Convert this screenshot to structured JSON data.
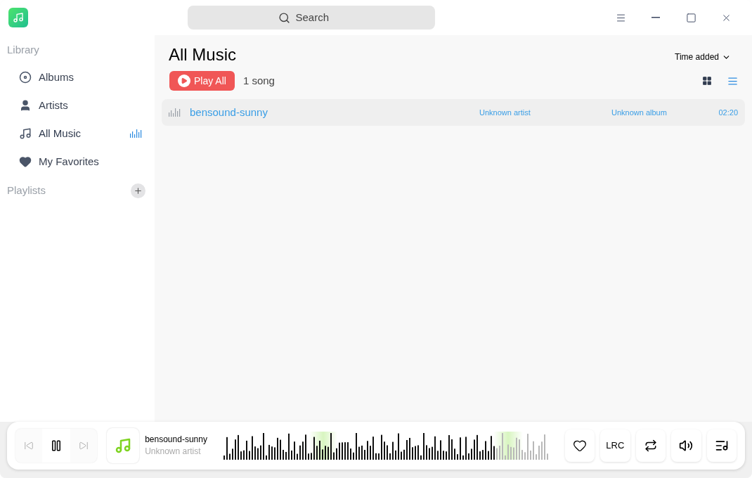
{
  "window": {
    "search": {
      "placeholder": "Search"
    }
  },
  "sidebar": {
    "library_heading": "Library",
    "items": [
      {
        "kind": "album",
        "label": "Albums",
        "selected": false
      },
      {
        "kind": "artist",
        "label": "Artists",
        "selected": false
      },
      {
        "kind": "music",
        "label": "All Music",
        "selected": true
      },
      {
        "kind": "heart",
        "label": "My Favorites",
        "selected": false
      }
    ],
    "playlists_heading": "Playlists"
  },
  "main": {
    "title": "All Music",
    "sort": "Time added",
    "play_all": "Play All",
    "count": "1 song",
    "views": [
      {
        "kind": "grid",
        "selected": false
      },
      {
        "kind": "list",
        "selected": true
      }
    ],
    "songs": [
      {
        "title": "bensound-sunny",
        "artist": "Unknown artist",
        "album": "Unknown album",
        "duration": "02:20",
        "playing": true
      }
    ]
  },
  "player": {
    "playing": true,
    "title": "bensound-sunny",
    "artist": "Unknown artist",
    "progress": {
      "level": 0.83
    },
    "favorite": false,
    "lyrics": "LRC"
  }
}
